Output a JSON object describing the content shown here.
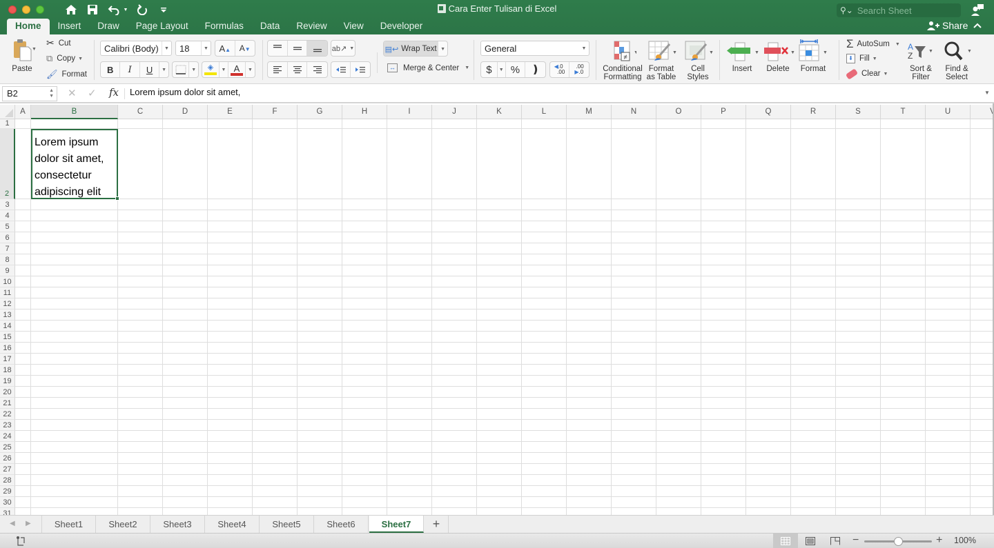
{
  "window": {
    "title": "Cara Enter Tulisan di Excel",
    "search_placeholder": "Search Sheet",
    "share_label": "Share"
  },
  "tabs": [
    {
      "label": "Home",
      "active": true
    },
    {
      "label": "Insert"
    },
    {
      "label": "Draw"
    },
    {
      "label": "Page Layout"
    },
    {
      "label": "Formulas"
    },
    {
      "label": "Data"
    },
    {
      "label": "Review"
    },
    {
      "label": "View"
    },
    {
      "label": "Developer"
    }
  ],
  "ribbon": {
    "clipboard": {
      "paste": "Paste",
      "cut": "Cut",
      "copy": "Copy",
      "format": "Format"
    },
    "font": {
      "name": "Calibri (Body)",
      "size": "18",
      "bold": "B",
      "italic": "I",
      "underline": "U",
      "highlight_color": "#f3e500",
      "font_color": "#d0312d"
    },
    "alignment": {
      "wrap_text": "Wrap Text",
      "merge_center": "Merge & Center"
    },
    "number": {
      "format": "General",
      "currency": "$",
      "percent": "%",
      "comma": "›",
      "inc_decimal": ".0\n.00",
      "dec_decimal": ".00\n.0"
    },
    "styles": {
      "conditional_formatting_1": "Conditional",
      "conditional_formatting_2": "Formatting",
      "format_as_table_1": "Format",
      "format_as_table_2": "as Table",
      "cell_styles_1": "Cell",
      "cell_styles_2": "Styles"
    },
    "cells": {
      "insert": "Insert",
      "delete": "Delete",
      "format": "Format"
    },
    "editing": {
      "autosum": "AutoSum",
      "fill": "Fill",
      "clear": "Clear",
      "sort_filter_1": "Sort &",
      "sort_filter_2": "Filter",
      "find_select_1": "Find &",
      "find_select_2": "Select"
    }
  },
  "formula_bar": {
    "name_box": "B2",
    "fx": "fx",
    "content": "Lorem ipsum dolor sit amet,"
  },
  "grid": {
    "columns": [
      "A",
      "B",
      "C",
      "D",
      "E",
      "F",
      "G",
      "H",
      "I",
      "J",
      "K",
      "L",
      "M",
      "N",
      "O",
      "P",
      "Q",
      "R",
      "S",
      "T",
      "U",
      "V"
    ],
    "selected_column": "B",
    "rows": [
      "1",
      "2",
      "3",
      "4",
      "5",
      "6",
      "7",
      "8",
      "9",
      "10",
      "11",
      "12",
      "13",
      "14",
      "15",
      "16",
      "17",
      "18",
      "19",
      "20",
      "21",
      "22",
      "23",
      "24",
      "25",
      "26",
      "27",
      "28",
      "29",
      "30",
      "31"
    ],
    "selected_row": "2",
    "active_cell": {
      "ref": "B2",
      "lines": [
        "Lorem ipsum",
        "dolor sit amet,",
        "consectetur",
        "adipiscing elit"
      ]
    }
  },
  "sheets": [
    {
      "label": "Sheet1"
    },
    {
      "label": "Sheet2"
    },
    {
      "label": "Sheet3"
    },
    {
      "label": "Sheet4"
    },
    {
      "label": "Sheet5"
    },
    {
      "label": "Sheet6"
    },
    {
      "label": "Sheet7",
      "active": true
    }
  ],
  "add_sheet_label": "+",
  "status": {
    "zoom_percent": "100%",
    "zoom_level": 1.0,
    "accent_color": "#2b6f42"
  }
}
